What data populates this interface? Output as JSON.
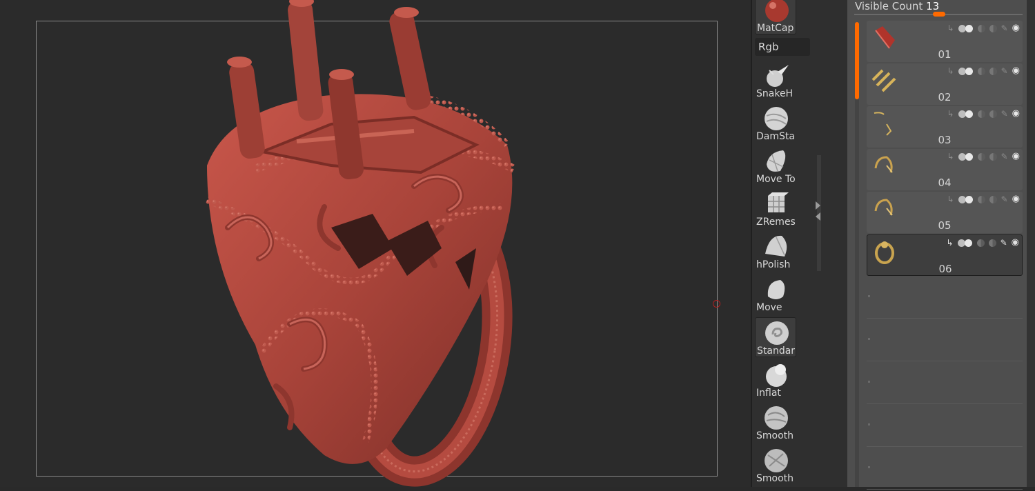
{
  "viewport": {
    "background": "#2b2b2b",
    "model_color": "#b5473e"
  },
  "shelf": {
    "material_label": "MatCap",
    "color_mode_label": "Rgb",
    "brushes": [
      {
        "label": "SnakeH",
        "icon": "snake-hook-brush-icon"
      },
      {
        "label": "DamSta",
        "icon": "dam-standard-brush-icon"
      },
      {
        "label": "Move To",
        "icon": "move-topological-brush-icon"
      },
      {
        "label": "ZRemes",
        "icon": "zremesher-guide-brush-icon"
      },
      {
        "label": "hPolish",
        "icon": "hpolish-brush-icon"
      },
      {
        "label": "Move",
        "icon": "move-brush-icon"
      },
      {
        "label": "Standar",
        "icon": "standard-brush-icon",
        "selected": true
      },
      {
        "label": "Inflat",
        "icon": "inflate-brush-icon"
      },
      {
        "label": "Smooth",
        "icon": "smooth-valleys-brush-icon"
      },
      {
        "label": "Smooth",
        "icon": "smooth-stronger-brush-icon"
      }
    ]
  },
  "subtool": {
    "visible_count_label": "Visible Count",
    "visible_count_value": "13",
    "accent": "#ff6a00",
    "items": [
      {
        "name": "01",
        "thumb": "ruby-gem-thumbnail"
      },
      {
        "name": "02",
        "thumb": "gold-prongs-thumbnail"
      },
      {
        "name": "03",
        "thumb": "gold-wire-thumbnail"
      },
      {
        "name": "04",
        "thumb": "gold-ring-filigree-thumbnail"
      },
      {
        "name": "05",
        "thumb": "gold-ring-filigree-thumbnail"
      },
      {
        "name": "06",
        "thumb": "gold-ring-band-thumbnail",
        "active": true
      }
    ]
  }
}
